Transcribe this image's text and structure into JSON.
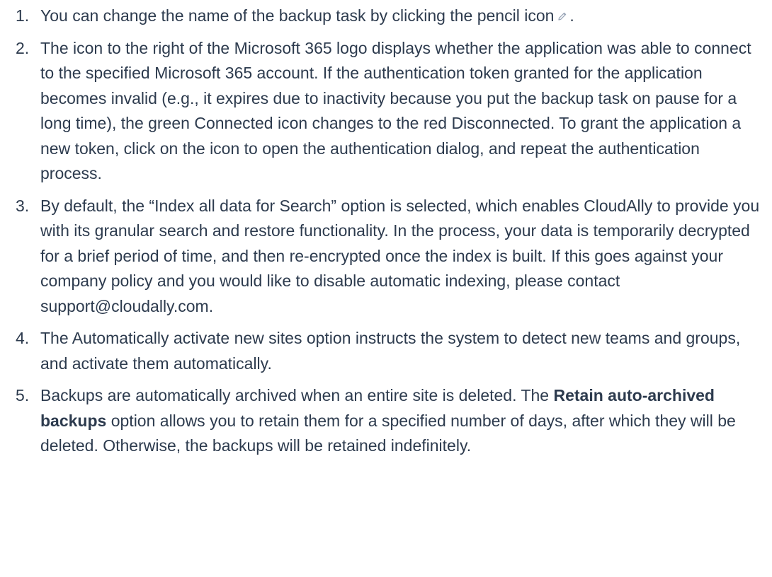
{
  "steps": [
    {
      "num": "1.",
      "text_before_icon": "You can change the name of the backup task by clicking the pencil icon",
      "icon": "pencil-icon",
      "text_after_icon": "."
    },
    {
      "num": "2.",
      "text": "The icon to the right of the Microsoft 365 logo displays whether the application was able to connect to the specified Microsoft 365 account. If the authentication token granted for the application becomes invalid (e.g., it expires due to inactivity because you put the backup task on pause for a long time), the green Connected icon changes to the red Disconnected. To grant the application a new token, click on the icon to open the authentication dialog, and repeat the authentication process."
    },
    {
      "num": "3.",
      "text": "By default, the “Index all data for Search” option is selected, which enables CloudAlly to provide you with its granular search and restore functionality. In the process, your data is temporarily decrypted for a brief period of time, and then re-encrypted once the index is built. If this goes against your company policy and you would like to disable automatic indexing, please contact support@cloudally.com."
    },
    {
      "num": "4.",
      "text": "The Automatically activate new sites option instructs the system to detect new teams and groups, and activate them automatically."
    },
    {
      "num": "5.",
      "text_before_bold": "Backups are automatically archived when an entire site is deleted. The ",
      "bold": "Retain auto-archived backups",
      "text_after_bold": " option allows you to retain them for a specified number of days, after which they will be deleted. Otherwise, the backups will be retained indefinitely."
    }
  ]
}
